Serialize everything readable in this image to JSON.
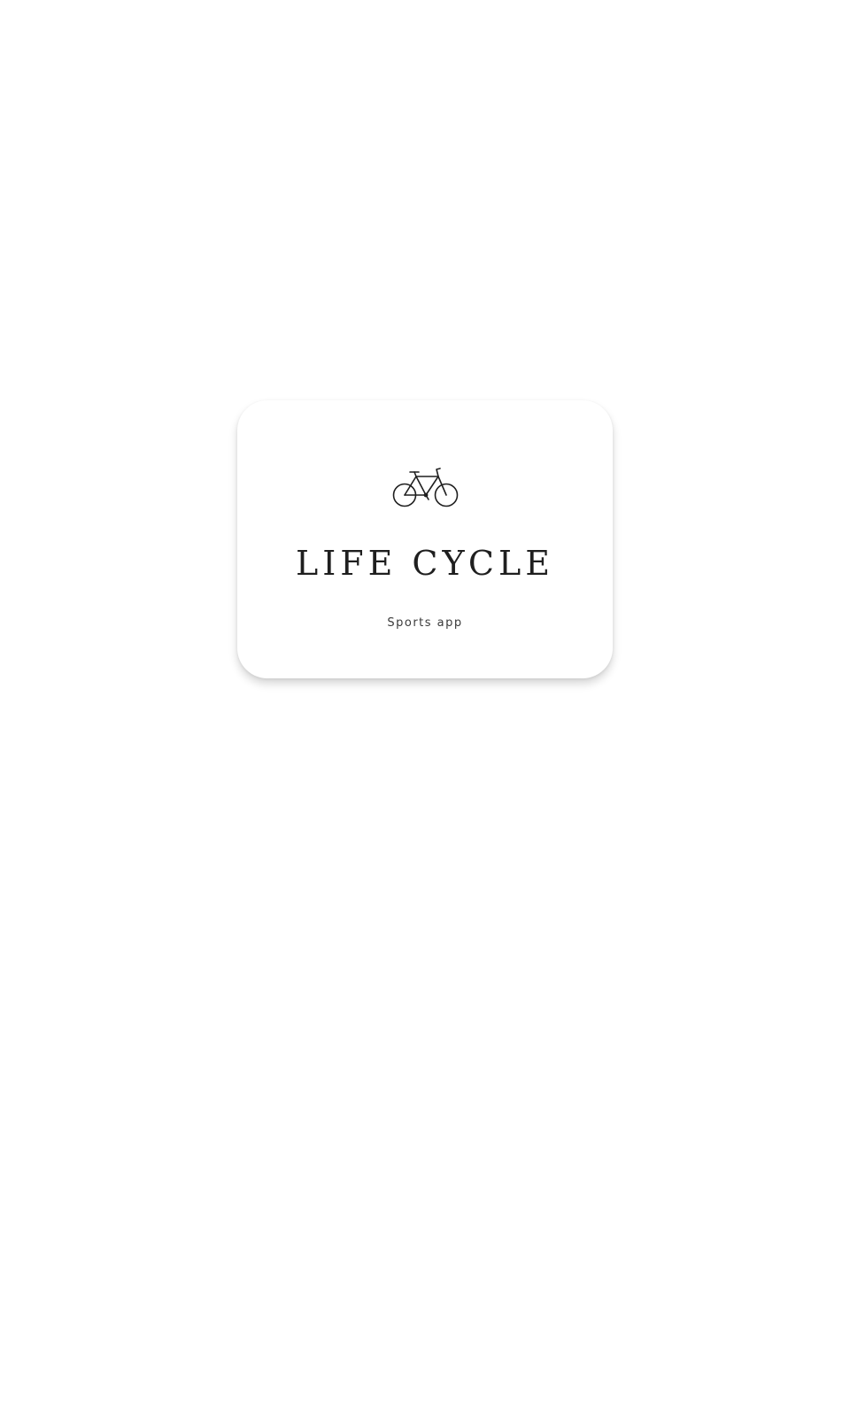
{
  "logo": {
    "icon": "bicycle-icon",
    "title": "LIFE CYCLE",
    "subtitle": "Sports app"
  },
  "colors": {
    "background": "#ffffff",
    "card": "#ffffff",
    "text": "#1f1f1f"
  }
}
